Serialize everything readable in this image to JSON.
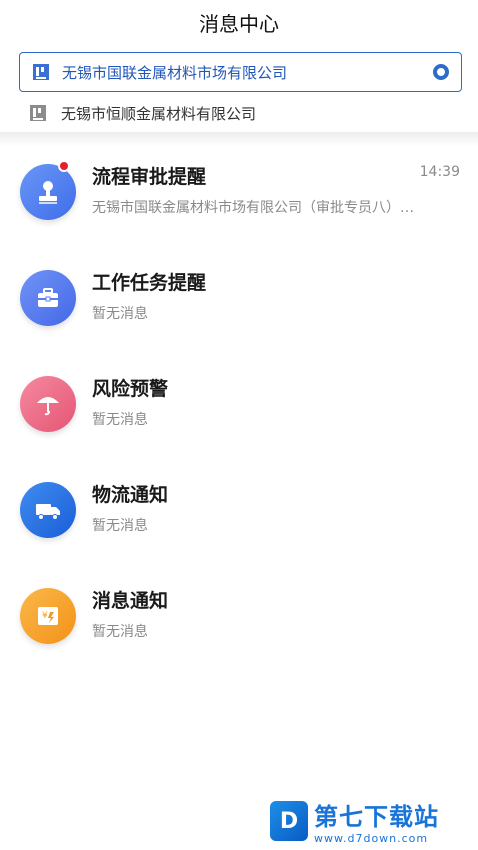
{
  "header": {
    "title": "消息中心"
  },
  "companies": {
    "selected": {
      "name": "无锡市国联金属材料市场有限公司"
    },
    "other": {
      "name": "无锡市恒顺金属材料有限公司"
    }
  },
  "messages": [
    {
      "title": "流程审批提醒",
      "subtitle": "无锡市国联金属材料市场有限公司（审批专员八）…",
      "time": "14:39",
      "icon": "stamp-icon",
      "color": "#4a7df0"
    },
    {
      "title": "工作任务提醒",
      "subtitle": "暂无消息",
      "icon": "briefcase-icon",
      "color": "#4f76ee"
    },
    {
      "title": "风险预警",
      "subtitle": "暂无消息",
      "icon": "umbrella-icon",
      "color": "#ee6f8a"
    },
    {
      "title": "物流通知",
      "subtitle": "暂无消息",
      "icon": "truck-icon",
      "color": "#2a74e6"
    },
    {
      "title": "消息通知",
      "subtitle": "暂无消息",
      "icon": "notice-icon",
      "color": "#f5a623"
    }
  ],
  "watermark": {
    "name": "第七下载站",
    "url": "www.d7down.com",
    "logo": "D"
  }
}
